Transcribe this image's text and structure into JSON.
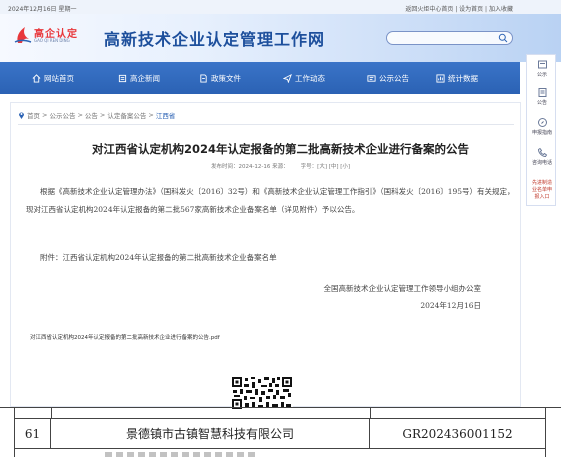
{
  "topbar": {
    "date": "2024年12月16日 星期一",
    "links": "返回火炬中心首页 | 设为首页 | 加入收藏"
  },
  "header": {
    "brand": "高企认定",
    "brand_en": "GAO QI REN DING",
    "site_title": "高新技术企业认定管理工作网",
    "search_placeholder": ""
  },
  "nav": {
    "items": [
      {
        "label": "网站首页",
        "icon": "home-icon"
      },
      {
        "label": "高企新闻",
        "icon": "news-icon"
      },
      {
        "label": "政策文件",
        "icon": "document-icon"
      },
      {
        "label": "工作动态",
        "icon": "plane-icon"
      },
      {
        "label": "公示公告",
        "icon": "bulletin-icon"
      },
      {
        "label": "统计数据",
        "icon": "stats-icon"
      }
    ]
  },
  "float": {
    "items": [
      {
        "label": "公示",
        "icon": "bulletin-icon"
      },
      {
        "label": "公告",
        "icon": "notice-icon"
      },
      {
        "label": "申报指南",
        "icon": "compass-icon"
      },
      {
        "label": "咨询电话",
        "icon": "phone-icon"
      },
      {
        "label1": "先进制造",
        "label2": "业名单申",
        "label3": "报入口"
      }
    ]
  },
  "breadcrumb": {
    "items": [
      "首页",
      "公示公告",
      "公告",
      "认定备案公告",
      "江西省"
    ]
  },
  "article": {
    "title": "对江西省认定机构2024年认定报备的第二批高新技术企业进行备案的公告",
    "published": "发布时间：2024-12-16 来源：",
    "fontsize": "字号：[大] [中] [小]",
    "para1": "根据《高新技术企业认定管理办法》（国科发火〔2016〕32号）和《高新技术企业认定管理工作指引》（国科发火〔2016〕195号）有关规定，现对江西省认定机构2024年认定报备的第二批567家高新技术企业备案名单（详见附件）予以公告。",
    "para2": "附件：江西省认定机构2024年认定报备的第二批高新技术企业备案名单",
    "sign_org": "全国高新技术企业认定管理工作领导小组办公室",
    "sign_date": "2024年12月16日",
    "attachment": "对江西省认定机构2024年认定报备的第二批高新技术企业进行备案的公告.pdf"
  },
  "table": {
    "row": {
      "no": "61",
      "company": "景德镇市古镇智慧科技有限公司",
      "code": "GR202436001152"
    }
  }
}
